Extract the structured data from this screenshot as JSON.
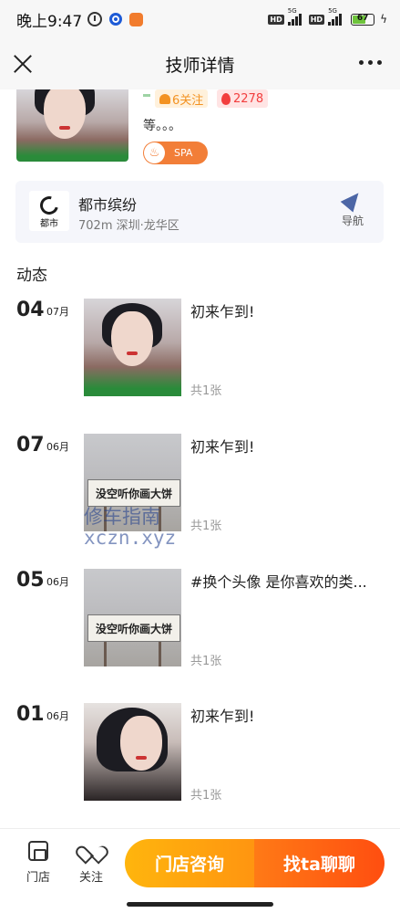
{
  "status_bar": {
    "time": "晚上9:47",
    "battery": "67",
    "network_1": "5G",
    "network_2": "5G",
    "hd_1": "HD",
    "hd_2": "HD"
  },
  "nav": {
    "title": "技师详情"
  },
  "profile": {
    "follow_tag": "6关注",
    "fire_tag": "2278",
    "intro": "等。。。",
    "service_tag": "SPA"
  },
  "store": {
    "logo_text": "都市",
    "name": "都市缤纷",
    "distance": "702m 深圳·龙华区",
    "nav_label": "导航"
  },
  "feed": {
    "title": "动态",
    "items": [
      {
        "day": "04",
        "month": "07月",
        "text": "初来乍到!",
        "count": "共1张",
        "photo": "portrait"
      },
      {
        "day": "07",
        "month": "06月",
        "text": "初来乍到!",
        "count": "共1张",
        "photo": "billboard",
        "billboard_text": "没空听你画大饼"
      },
      {
        "day": "05",
        "month": "06月",
        "text": "#换个头像 是你喜欢的类...",
        "count": "共1张",
        "photo": "billboard",
        "billboard_text": "没空听你画大饼"
      },
      {
        "day": "01",
        "month": "06月",
        "text": "初来乍到!",
        "count": "共1张",
        "photo": "portrait-dark"
      }
    ]
  },
  "watermark": {
    "line1": "修车指南",
    "line2": "xczn.xyz"
  },
  "bottom_bar": {
    "store_label": "门店",
    "follow_label": "关注",
    "store_consult": "门店咨询",
    "chat": "找ta聊聊"
  },
  "colors": {
    "accent_orange": "#ff9510",
    "accent_red": "#ff4e10",
    "nav_icon": "#4c66a6"
  }
}
